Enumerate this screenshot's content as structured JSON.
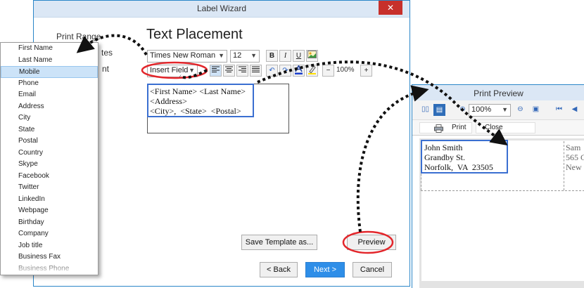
{
  "wizard": {
    "title": "Label Wizard",
    "close_glyph": "✕",
    "nav": [
      "Print Range",
      "tes",
      "nt"
    ],
    "heading": "Text Placement",
    "font_name": "Times New Roman",
    "font_size": "12",
    "insert_field": "Insert Field",
    "zoom": "100%",
    "format_buttons": {
      "bold": "B",
      "italic": "I",
      "underline": "U"
    },
    "text_lines": [
      "<First Name> <Last Name>",
      "<Address>",
      "<City>,  <State>  <Postal>"
    ],
    "buttons": {
      "save_template": "Save Template as...",
      "preview": "Preview",
      "back": "< Back",
      "next": "Next >",
      "cancel": "Cancel"
    }
  },
  "field_list": {
    "items": [
      "First Name",
      "Last Name",
      "Mobile",
      "Phone",
      "Email",
      "Address",
      "City",
      "State",
      "Postal",
      "Country",
      "Skype",
      "Facebook",
      "Twitter",
      "LinkedIn",
      "Webpage",
      "Birthday",
      "Company",
      "Job title",
      "Business Fax",
      "Business Phone"
    ],
    "selected": "Mobile"
  },
  "print_preview": {
    "title": "Print Preview",
    "zoom": "100%",
    "print_label": "Print",
    "close_label": "Close",
    "label_lines": [
      "John Smith",
      "Grandby St.",
      "Norfolk,  VA  23505"
    ],
    "next_label_lines": [
      "Sam",
      "565 C",
      "New"
    ]
  },
  "colors": {
    "accent": "#2a86c8",
    "highlight_box": "#3a6fd1",
    "circle": "#e3262b",
    "close_red": "#c7302b",
    "primary_button": "#2e8ee8"
  },
  "icons": [
    "close-icon",
    "bold-icon",
    "italic-icon",
    "underline-icon",
    "image-icon",
    "align-left-icon",
    "align-center-icon",
    "align-right-icon",
    "justify-icon",
    "undo-icon",
    "redo-icon",
    "font-color-icon",
    "highlight-icon",
    "printer-icon",
    "zoom-in-icon",
    "zoom-out-icon",
    "first-page-icon",
    "prev-page-icon"
  ]
}
